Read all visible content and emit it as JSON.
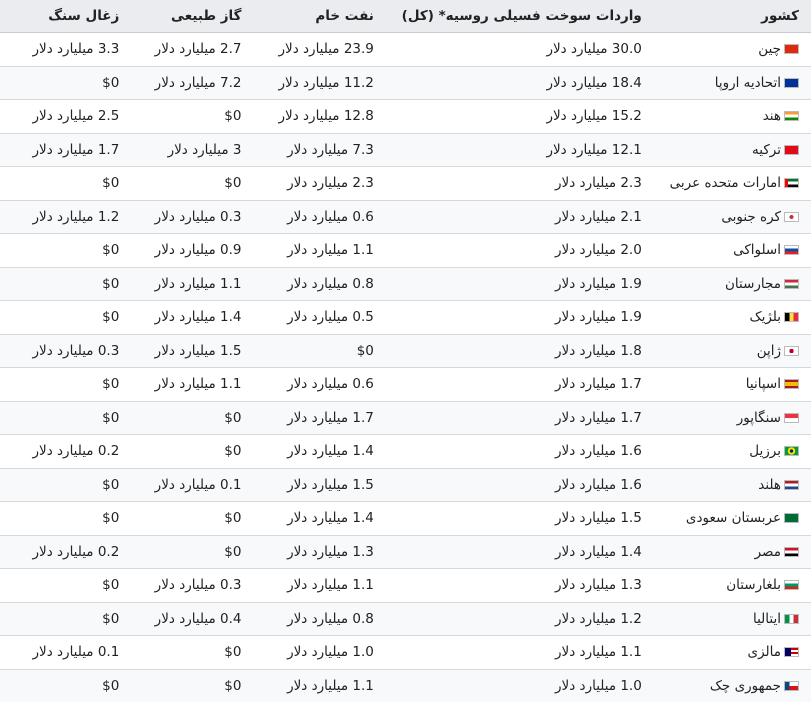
{
  "headers": [
    "کشور",
    "واردات سوخت فسیلی روسیه* (کل)",
    "نفت خام",
    "گاز طبیعی",
    "زغال سنگ"
  ],
  "rows": [
    {
      "country": "چین",
      "flag": "flag-china-icon",
      "flag_bg": "linear-gradient(#de2910,#de2910)",
      "total": "30.0 میلیارد دلار",
      "oil": "23.9 میلیارد دلار",
      "gas": "2.7 میلیارد دلار",
      "coal": "3.3 میلیارد دلار"
    },
    {
      "country": "اتحادیه اروپا",
      "flag": "flag-eu-icon",
      "flag_bg": "linear-gradient(#003399,#003399)",
      "total": "18.4 میلیارد دلار",
      "oil": "11.2 میلیارد دلار",
      "gas": "7.2 میلیارد دلار",
      "coal": "$0"
    },
    {
      "country": "هند",
      "flag": "flag-india-icon",
      "flag_bg": "linear-gradient(#ff9933 33%,#ffffff 33%,#ffffff 66%,#138808 66%)",
      "total": "15.2 میلیارد دلار",
      "oil": "12.8 میلیارد دلار",
      "gas": "$0",
      "coal": "2.5 میلیارد دلار"
    },
    {
      "country": "ترکیه",
      "flag": "flag-turkey-icon",
      "flag_bg": "linear-gradient(#e30a17,#e30a17)",
      "total": "12.1 میلیارد دلار",
      "oil": "7.3 میلیارد دلار",
      "gas": "3 میلیارد دلار",
      "coal": "1.7 میلیارد دلار"
    },
    {
      "country": "امارات متحده عربی",
      "flag": "flag-uae-icon",
      "flag_bg": "linear-gradient(to right,#ff0000 25%,transparent 25%),linear-gradient(#00732f 33%,#ffffff 33%,#ffffff 66%,#000000 66%)",
      "total": "2.3 میلیارد دلار",
      "oil": "2.3 میلیارد دلار",
      "gas": "$0",
      "coal": "$0"
    },
    {
      "country": "کره جنوبی",
      "flag": "flag-south-korea-icon",
      "flag_bg": "radial-gradient(circle,#cd2e3a 0 25%,#ffffff 27%)",
      "total": "2.1 میلیارد دلار",
      "oil": "0.6 میلیارد دلار",
      "gas": "0.3 میلیارد دلار",
      "coal": "1.2 میلیارد دلار"
    },
    {
      "country": "اسلواکی",
      "flag": "flag-slovakia-icon",
      "flag_bg": "linear-gradient(#ffffff 33%,#0b4ea2 33%,#0b4ea2 66%,#ee1c25 66%)",
      "total": "2.0 میلیارد دلار",
      "oil": "1.1 میلیارد دلار",
      "gas": "0.9 میلیارد دلار",
      "coal": "$0"
    },
    {
      "country": "مجارستان",
      "flag": "flag-hungary-icon",
      "flag_bg": "linear-gradient(#ce2939 33%,#ffffff 33%,#ffffff 66%,#477050 66%)",
      "total": "1.9 میلیارد دلار",
      "oil": "0.8 میلیارد دلار",
      "gas": "1.1 میلیارد دلار",
      "coal": "$0"
    },
    {
      "country": "بلژیک",
      "flag": "flag-belgium-icon",
      "flag_bg": "linear-gradient(to right,#000000 33%,#fae042 33%,#fae042 66%,#ed2939 66%)",
      "total": "1.9 میلیارد دلار",
      "oil": "0.5 میلیارد دلار",
      "gas": "1.4 میلیارد دلار",
      "coal": "$0"
    },
    {
      "country": "ژاپن",
      "flag": "flag-japan-icon",
      "flag_bg": "radial-gradient(circle,#bc002d 0 28%,#ffffff 30%)",
      "total": "1.8 میلیارد دلار",
      "oil": "$0",
      "gas": "1.5 میلیارد دلار",
      "coal": "0.3 میلیارد دلار"
    },
    {
      "country": "اسپانیا",
      "flag": "flag-spain-icon",
      "flag_bg": "linear-gradient(#aa151b 25%,#f1bf00 25%,#f1bf00 75%,#aa151b 75%)",
      "total": "1.7 میلیارد دلار",
      "oil": "0.6 میلیارد دلار",
      "gas": "1.1 میلیارد دلار",
      "coal": "$0"
    },
    {
      "country": "سنگاپور",
      "flag": "flag-singapore-icon",
      "flag_bg": "linear-gradient(#ef3340 50%,#ffffff 50%)",
      "total": "1.7 میلیارد دلار",
      "oil": "1.7 میلیارد دلار",
      "gas": "$0",
      "coal": "$0"
    },
    {
      "country": "برزیل",
      "flag": "flag-brazil-icon",
      "flag_bg": "radial-gradient(circle,#002776 0 22%,#ffdf00 24% 48%,#009c3b 50%)",
      "total": "1.6 میلیارد دلار",
      "oil": "1.4 میلیارد دلار",
      "gas": "$0",
      "coal": "0.2 میلیارد دلار"
    },
    {
      "country": "هلند",
      "flag": "flag-netherlands-icon",
      "flag_bg": "linear-gradient(#ae1c28 33%,#ffffff 33%,#ffffff 66%,#21468b 66%)",
      "total": "1.6 میلیارد دلار",
      "oil": "1.5 میلیارد دلار",
      "gas": "0.1 میلیارد دلار",
      "coal": "$0"
    },
    {
      "country": "عربستان سعودی",
      "flag": "flag-saudi-arabia-icon",
      "flag_bg": "linear-gradient(#006c35,#006c35)",
      "total": "1.5 میلیارد دلار",
      "oil": "1.4 میلیارد دلار",
      "gas": "$0",
      "coal": "$0"
    },
    {
      "country": "مصر",
      "flag": "flag-egypt-icon",
      "flag_bg": "linear-gradient(#ce1126 33%,#ffffff 33%,#ffffff 66%,#000000 66%)",
      "total": "1.4 میلیارد دلار",
      "oil": "1.3 میلیارد دلار",
      "gas": "$0",
      "coal": "0.2 میلیارد دلار"
    },
    {
      "country": "بلغارستان",
      "flag": "flag-bulgaria-icon",
      "flag_bg": "linear-gradient(#ffffff 33%,#00966e 33%,#00966e 66%,#d62612 66%)",
      "total": "1.3 میلیارد دلار",
      "oil": "1.1 میلیارد دلار",
      "gas": "0.3 میلیارد دلار",
      "coal": "$0"
    },
    {
      "country": "ایتالیا",
      "flag": "flag-italy-icon",
      "flag_bg": "linear-gradient(to right,#009246 33%,#ffffff 33%,#ffffff 66%,#ce2b37 66%)",
      "total": "1.2 میلیارد دلار",
      "oil": "0.8 میلیارد دلار",
      "gas": "0.4 میلیارد دلار",
      "coal": "$0"
    },
    {
      "country": "مالزی",
      "flag": "flag-malaysia-icon",
      "flag_bg": "linear-gradient(to right,#010066 45%,transparent 45%),repeating-linear-gradient(#cc0001 0 2px,#ffffff 2px 4px)",
      "total": "1.1 میلیارد دلار",
      "oil": "1.0 میلیارد دلار",
      "gas": "$0",
      "coal": "0.1 میلیارد دلار"
    },
    {
      "country": "جمهوری چک",
      "flag": "flag-czech-republic-icon",
      "flag_bg": "linear-gradient(to right,#11457e 35%,transparent 35%),linear-gradient(#ffffff 50%,#d7141a 50%)",
      "total": "1.0 میلیارد دلار",
      "oil": "1.1 میلیارد دلار",
      "gas": "$0",
      "coal": "$0"
    }
  ]
}
